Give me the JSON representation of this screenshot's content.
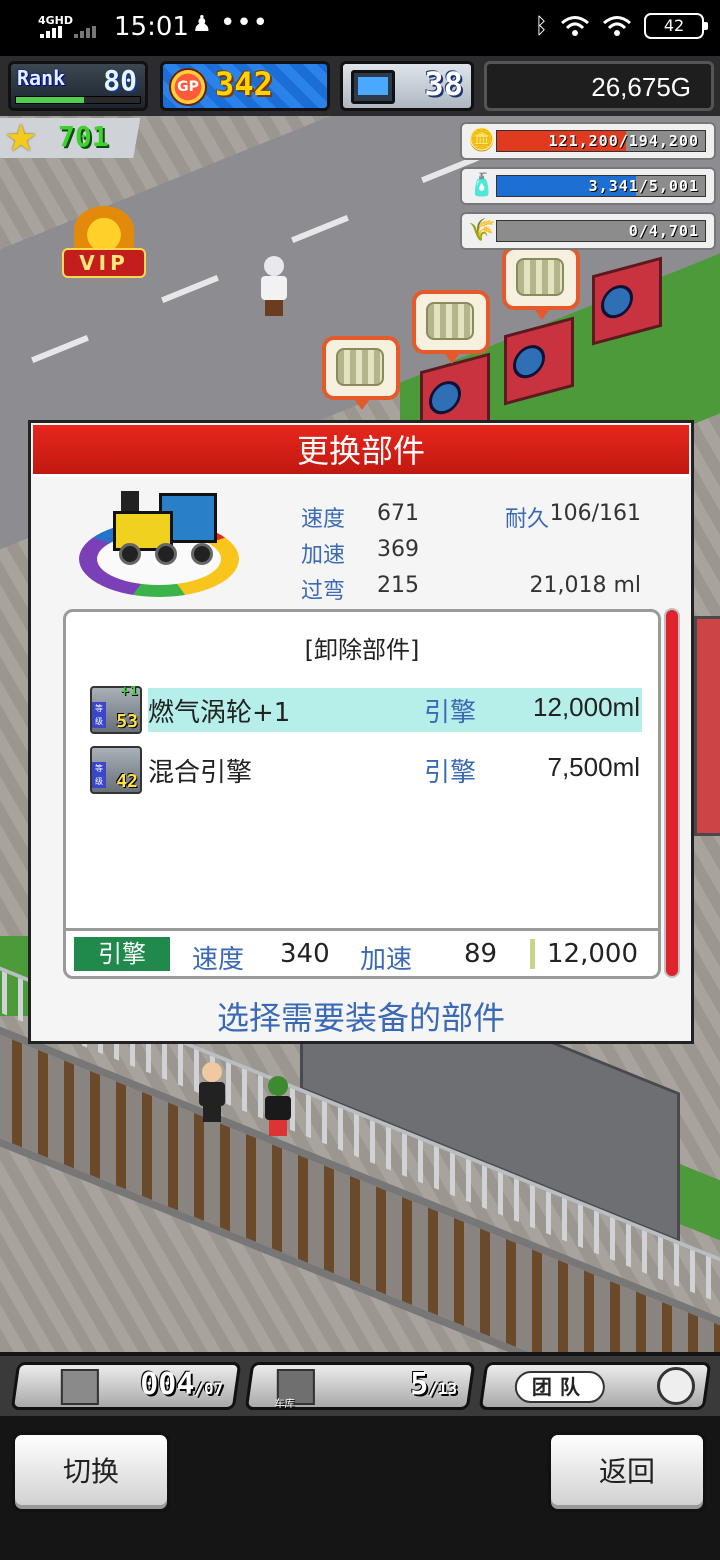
{
  "status_bar": {
    "network": "4GHD",
    "time": "15:01",
    "dots": "•••",
    "battery": "42"
  },
  "hud": {
    "rank_label": "Rank",
    "rank": "80",
    "rank_progress": 0.55,
    "gp_label": "GP",
    "gp": "342",
    "computers": "38",
    "money": "26,675G",
    "stars": "701"
  },
  "resources": [
    {
      "icon": "coin-stack-icon",
      "text": "121,200/194,200",
      "fill": 0.62,
      "color": "#e03a1f"
    },
    {
      "icon": "fuel-tank-icon",
      "text": "3,341/5,001",
      "fill": 0.67,
      "color": "#1e6fd4"
    },
    {
      "icon": "wheat-icon",
      "text": "0/4,701",
      "fill": 0.0,
      "color": "#5fae2a"
    }
  ],
  "scene": {
    "vip_label": "VIP"
  },
  "dialog": {
    "title": "更换部件",
    "stats": {
      "speed_label": "速度",
      "speed": "671",
      "durability_label": "耐久",
      "durability": "106/161",
      "accel_label": "加速",
      "accel": "369",
      "corner_label": "过弯",
      "corner": "215",
      "fuel": "21,018 ml"
    },
    "parts_header": "[卸除部件]",
    "parts": [
      {
        "name": "燃气涡轮+1",
        "type": "引擎",
        "price": "12,000ml",
        "level": "53",
        "plus": "+1",
        "ribbon": "等级",
        "selected": true
      },
      {
        "name": "混合引擎",
        "type": "引擎",
        "price": "7,500ml",
        "level": "42",
        "plus": "",
        "ribbon": "等级",
        "selected": false
      }
    ],
    "summary": {
      "type": "引擎",
      "speed_label": "速度",
      "speed": "340",
      "accel_label": "加速",
      "accel": "89",
      "cost": "12,000"
    },
    "hint": "选择需要装备的部件"
  },
  "bottom": {
    "cars": "004",
    "cars_max": "/07",
    "garage_label": "车库",
    "garage": "5",
    "garage_max": "/13",
    "team_label": "团队",
    "switch_button": "切换",
    "back_button": "返回"
  }
}
